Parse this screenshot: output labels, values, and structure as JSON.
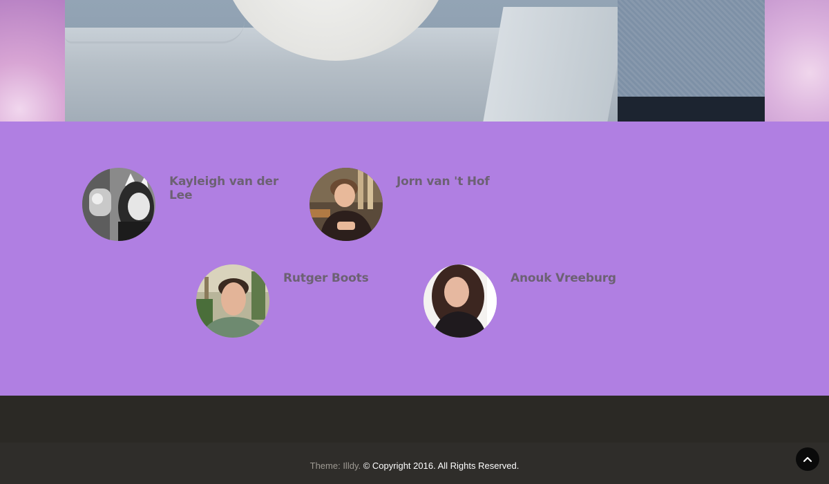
{
  "team": {
    "members": [
      {
        "name": "Kayleigh van der Lee",
        "avatar_icon": "portrait-photo"
      },
      {
        "name": "Jorn van 't Hof",
        "avatar_icon": "portrait-photo"
      },
      {
        "name": "Rutger Boots",
        "avatar_icon": "portrait-photo"
      },
      {
        "name": "Anouk Vreeburg",
        "avatar_icon": "portrait-photo"
      }
    ],
    "background_color": "#b07fe2",
    "name_color": "#6c6173"
  },
  "footer": {
    "theme_text": "Theme: Illdy.",
    "copyright_text": "© Copyright 2016. All Rights Reserved.",
    "background_color": "#2f2d2a"
  },
  "back_to_top": {
    "icon": "chevron-up-icon"
  }
}
